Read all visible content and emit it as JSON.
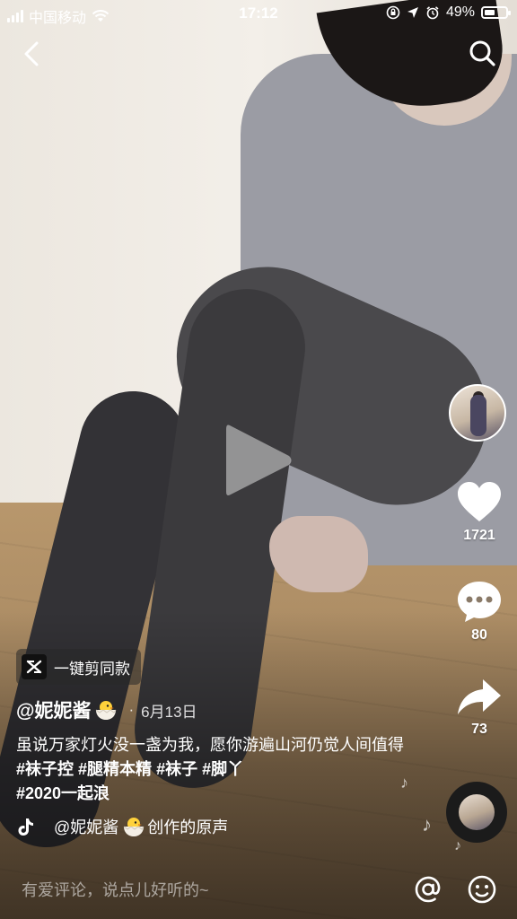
{
  "status_bar": {
    "carrier": "中国移动",
    "time": "17:12",
    "battery": "49%",
    "battery_level": 0.49
  },
  "video": {
    "playing": false
  },
  "rail": {
    "likes": "1721",
    "comments": "80",
    "shares": "73"
  },
  "capcut": {
    "label": "一键剪同款"
  },
  "post": {
    "author": "@妮妮酱",
    "date": "6月13日",
    "caption_text": "虽说万家灯火没一盏为我，愿你游遍山河仍觉人间值得",
    "hashtags": [
      "#袜子控",
      "#腿精本精",
      "#袜子",
      "#脚丫",
      "#2020一起浪"
    ]
  },
  "music": {
    "author": "@妮妮酱",
    "title": "创作的原声"
  },
  "comment_bar": {
    "placeholder": "有爱评论，说点儿好听的~"
  }
}
